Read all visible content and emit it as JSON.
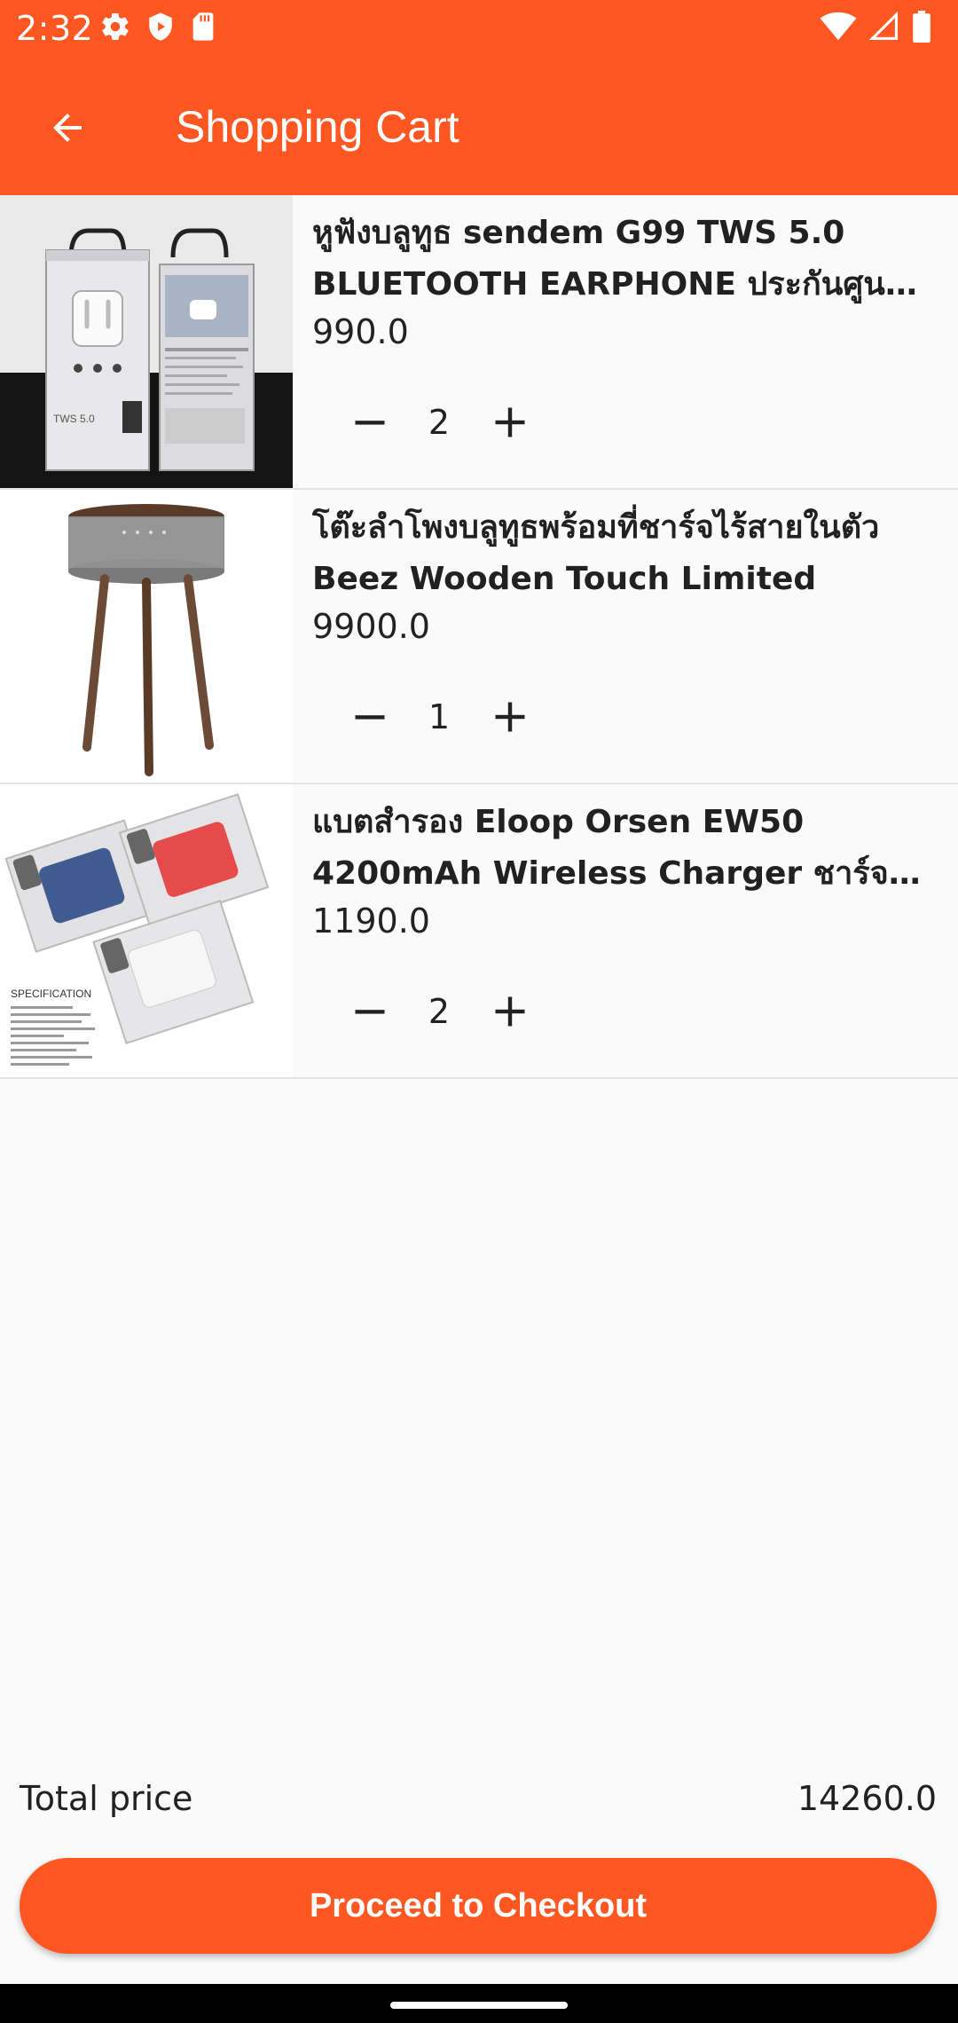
{
  "status_bar": {
    "time": "2:32",
    "icons": [
      "settings-icon",
      "shield-icon",
      "sd-card-icon",
      "wifi-icon",
      "signal-icon",
      "battery-icon"
    ]
  },
  "app_bar": {
    "title": "Shopping Cart",
    "back_icon": "arrow-left-icon"
  },
  "colors": {
    "accent": "#ff5722",
    "background": "#fafafa",
    "divider": "#e4e4e4"
  },
  "cart": {
    "items": [
      {
        "name": "หูฟังบลูทูธ sendem G99 TWS 5.0 BLUETOOTH EARPHONE ประกันศูนย์ ...",
        "price": "990.0",
        "quantity": "2",
        "thumb": "earbuds-box-image"
      },
      {
        "name": "โต๊ะลำโพงบลูทูธพร้อมที่ชาร์จไร้สายในตัว Beez Wooden Touch Limited",
        "price": "9900.0",
        "quantity": "1",
        "thumb": "speaker-table-image"
      },
      {
        "name": "แบตสำรอง Eloop Orsen EW50 4200mAh Wireless Charger ชาร์จไร้...",
        "price": "1190.0",
        "quantity": "2",
        "thumb": "powerbank-box-image"
      }
    ]
  },
  "summary": {
    "total_label": "Total price",
    "total_value": "14260.0",
    "checkout_label": "Proceed to Checkout"
  }
}
